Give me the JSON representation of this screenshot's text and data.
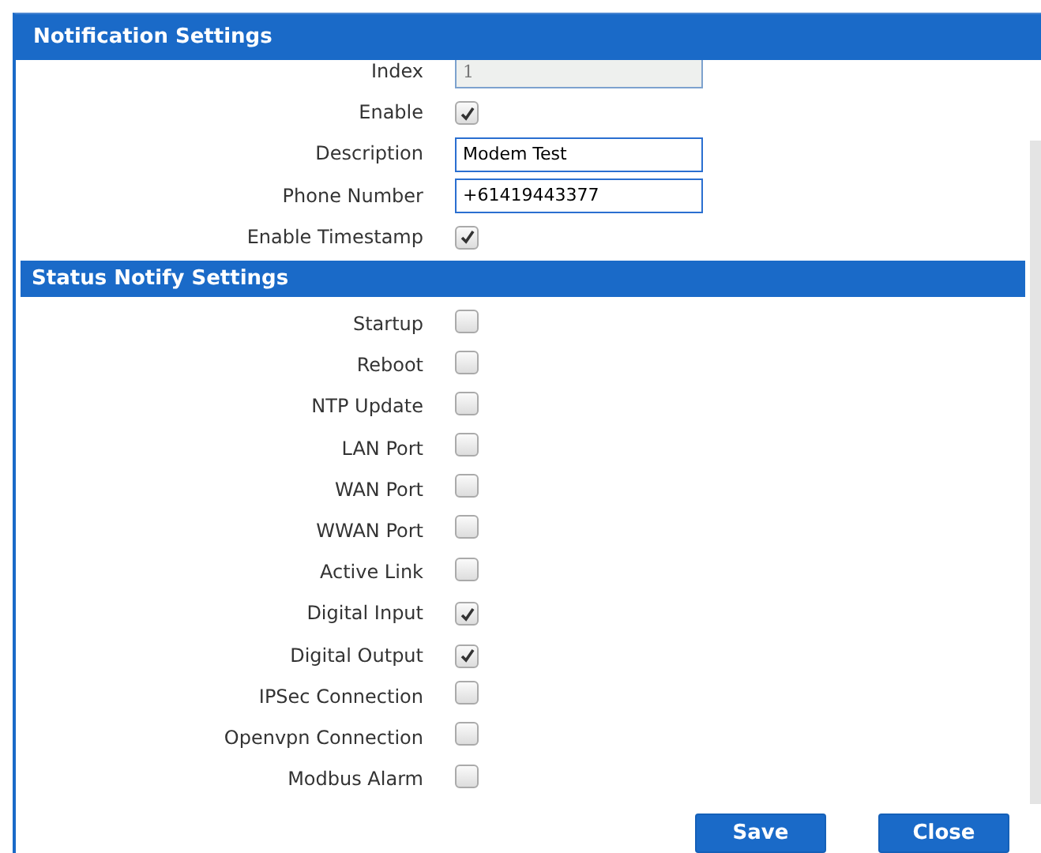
{
  "dialog": {
    "title": "Notification Settings"
  },
  "fields": [
    {
      "label": "Index",
      "kind": "input",
      "value": "1",
      "disabled": true
    },
    {
      "label": "Enable",
      "kind": "checkbox",
      "checked": true
    },
    {
      "label": "Description",
      "kind": "input",
      "value": "Modem Test",
      "disabled": false
    },
    {
      "label": "Phone Number",
      "kind": "input",
      "value": "+61419443377",
      "disabled": false
    },
    {
      "label": "Enable Timestamp",
      "kind": "checkbox",
      "checked": true
    }
  ],
  "status_section": {
    "title": "Status Notify Settings"
  },
  "status_items": [
    {
      "label": "Startup",
      "checked": false
    },
    {
      "label": "Reboot",
      "checked": false
    },
    {
      "label": "NTP Update",
      "checked": false
    },
    {
      "label": "LAN Port",
      "checked": false
    },
    {
      "label": "WAN Port",
      "checked": false
    },
    {
      "label": "WWAN Port",
      "checked": false
    },
    {
      "label": "Active Link",
      "checked": false
    },
    {
      "label": "Digital Input",
      "checked": true
    },
    {
      "label": "Digital Output",
      "checked": true
    },
    {
      "label": "IPSec Connection",
      "checked": false
    },
    {
      "label": "Openvpn Connection",
      "checked": false
    },
    {
      "label": "Modbus Alarm",
      "checked": false
    }
  ],
  "buttons": [
    "Save",
    "Close"
  ]
}
